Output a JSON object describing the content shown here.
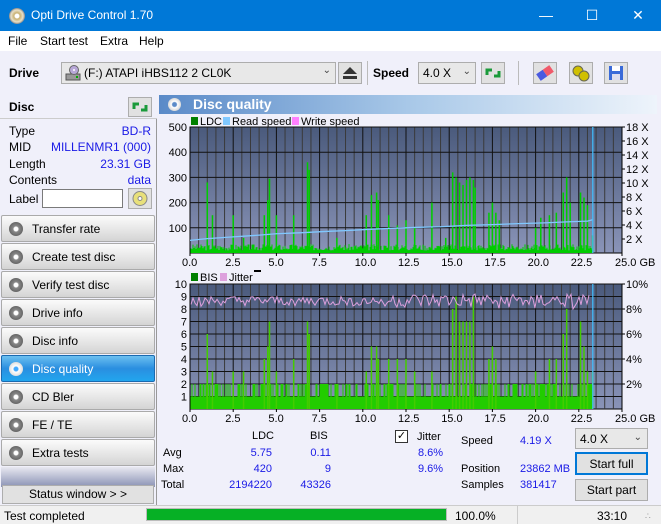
{
  "window": {
    "title": "Opti Drive Control 1.70",
    "controls": [
      "minimize",
      "maximize",
      "close"
    ]
  },
  "menu": [
    "File",
    "Start test",
    "Extra",
    "Help"
  ],
  "toolbar": {
    "drive_label": "Drive",
    "drive_value": "(F:)  ATAPI iHBS112  2 CL0K",
    "speed_label": "Speed",
    "speed_value": "4.0 X"
  },
  "disc": {
    "header": "Disc",
    "rows": [
      {
        "key": "Type",
        "value": "BD-R"
      },
      {
        "key": "MID",
        "value": "MILLENMR1 (000)"
      },
      {
        "key": "Length",
        "value": "23.31 GB"
      },
      {
        "key": "Contents",
        "value": "data"
      }
    ],
    "label_key": "Label",
    "label_value": ""
  },
  "nav": [
    {
      "label": "Transfer rate",
      "active": false
    },
    {
      "label": "Create test disc",
      "active": false
    },
    {
      "label": "Verify test disc",
      "active": false
    },
    {
      "label": "Drive info",
      "active": false
    },
    {
      "label": "Disc info",
      "active": false
    },
    {
      "label": "Disc quality",
      "active": true
    },
    {
      "label": "CD Bler",
      "active": false
    },
    {
      "label": "FE / TE",
      "active": false
    },
    {
      "label": "Extra tests",
      "active": false
    }
  ],
  "status_window_label": "Status window > >",
  "panel_title": "Disc quality",
  "chart_data": [
    {
      "type": "bar",
      "title": "LDC / Read speed",
      "legend": [
        "LDC",
        "Read speed",
        "Write speed"
      ],
      "legend_colors": [
        "#008000",
        "#80c8ff",
        "#ff80ff"
      ],
      "legend_placement": "top-left",
      "xlabel": "GB",
      "x_ticks": [
        "0.0",
        "2.5",
        "5.0",
        "7.5",
        "10.0",
        "12.5",
        "15.0",
        "17.5",
        "20.0",
        "22.5",
        "25.0 GB"
      ],
      "xlim": [
        0,
        25
      ],
      "y_ticks": [
        "100",
        "200",
        "300",
        "400",
        "500"
      ],
      "ylim": [
        0,
        500
      ],
      "y2_ticks": [
        "2 X",
        "4 X",
        "6 X",
        "8 X",
        "10 X",
        "12 X",
        "14 X",
        "16 X",
        "18 X"
      ],
      "y2lim": [
        0,
        18
      ],
      "ldc_peaks": [
        [
          1.0,
          280
        ],
        [
          1.3,
          150
        ],
        [
          2.5,
          150
        ],
        [
          3.1,
          60
        ],
        [
          4.3,
          150
        ],
        [
          4.5,
          210
        ],
        [
          4.6,
          295
        ],
        [
          5.0,
          150
        ],
        [
          6.0,
          150
        ],
        [
          6.8,
          360
        ],
        [
          6.9,
          330
        ],
        [
          8.5,
          60
        ],
        [
          10.2,
          150
        ],
        [
          10.5,
          230
        ],
        [
          10.8,
          240
        ],
        [
          10.9,
          210
        ],
        [
          11.5,
          150
        ],
        [
          12.0,
          110
        ],
        [
          12.5,
          130
        ],
        [
          13.0,
          100
        ],
        [
          14.0,
          200
        ],
        [
          14.8,
          60
        ],
        [
          15.2,
          320
        ],
        [
          15.4,
          300
        ],
        [
          15.6,
          280
        ],
        [
          15.8,
          270
        ],
        [
          16.0,
          290
        ],
        [
          16.2,
          300
        ],
        [
          16.4,
          290
        ],
        [
          16.5,
          260
        ],
        [
          17.3,
          160
        ],
        [
          17.5,
          200
        ],
        [
          17.7,
          160
        ],
        [
          17.9,
          130
        ],
        [
          20.0,
          100
        ],
        [
          20.3,
          140
        ],
        [
          20.8,
          150
        ],
        [
          21.2,
          160
        ],
        [
          21.6,
          240
        ],
        [
          21.8,
          300
        ],
        [
          22.0,
          200
        ],
        [
          22.6,
          240
        ],
        [
          22.8,
          220
        ],
        [
          23.0,
          190
        ],
        [
          23.3,
          70
        ]
      ],
      "ldc_baseline": 10,
      "read_speed": [
        [
          0,
          1.8
        ],
        [
          1,
          2.05
        ],
        [
          2.5,
          2.3
        ],
        [
          4,
          2.55
        ],
        [
          5,
          2.75
        ],
        [
          6.5,
          2.9
        ],
        [
          8,
          3.1
        ],
        [
          9,
          3.2
        ],
        [
          10.5,
          3.4
        ],
        [
          11.5,
          3.5
        ],
        [
          13,
          3.65
        ],
        [
          14.5,
          3.75
        ],
        [
          16,
          3.95
        ],
        [
          17.5,
          4.05
        ],
        [
          19,
          4.2
        ],
        [
          20.5,
          4.3
        ],
        [
          21.8,
          4.45
        ],
        [
          23,
          4.55
        ],
        [
          23.3,
          4.75
        ]
      ],
      "end_marker_gb": 23.31
    },
    {
      "type": "bar",
      "title": "BIS / Jitter",
      "legend": [
        "BIS",
        "Jitter"
      ],
      "legend_colors": [
        "#008000",
        "#dda0dd"
      ],
      "legend_placement": "top-left",
      "xlabel": "GB",
      "x_ticks": [
        "0.0",
        "2.5",
        "5.0",
        "7.5",
        "10.0",
        "12.5",
        "15.0",
        "17.5",
        "20.0",
        "22.5",
        "25.0 GB"
      ],
      "xlim": [
        0,
        25
      ],
      "y_ticks": [
        "1",
        "2",
        "3",
        "4",
        "5",
        "6",
        "7",
        "8",
        "9",
        "10"
      ],
      "ylim": [
        0,
        10
      ],
      "y2_ticks": [
        "2%",
        "4%",
        "6%",
        "8%",
        "10%"
      ],
      "y2lim": [
        0,
        10
      ],
      "bis_peaks": [
        [
          1.0,
          6
        ],
        [
          1.3,
          3
        ],
        [
          2.5,
          3
        ],
        [
          3.1,
          3
        ],
        [
          4.3,
          4
        ],
        [
          4.5,
          5
        ],
        [
          4.6,
          7
        ],
        [
          5.0,
          3
        ],
        [
          6.0,
          4
        ],
        [
          6.8,
          7
        ],
        [
          6.9,
          6
        ],
        [
          8.5,
          2
        ],
        [
          10.2,
          3
        ],
        [
          10.5,
          5
        ],
        [
          10.8,
          5
        ],
        [
          10.9,
          4
        ],
        [
          11.5,
          4
        ],
        [
          12.0,
          4
        ],
        [
          12.5,
          4
        ],
        [
          13.0,
          3
        ],
        [
          14.0,
          3
        ],
        [
          15.2,
          8
        ],
        [
          15.4,
          9
        ],
        [
          15.6,
          7
        ],
        [
          15.8,
          7
        ],
        [
          16.0,
          7
        ],
        [
          16.2,
          7
        ],
        [
          16.4,
          9
        ],
        [
          17.3,
          4
        ],
        [
          17.5,
          5
        ],
        [
          17.7,
          4
        ],
        [
          20.0,
          3
        ],
        [
          20.8,
          4
        ],
        [
          21.2,
          4
        ],
        [
          21.6,
          6
        ],
        [
          21.8,
          8
        ],
        [
          22.6,
          7
        ],
        [
          22.8,
          5
        ],
        [
          23.0,
          3
        ],
        [
          23.3,
          3
        ]
      ],
      "bis_baseline": 1,
      "jitter_mean_pct": 8.6,
      "jitter_max_pct": 9.6,
      "end_marker_gb": 23.31
    }
  ],
  "stats": {
    "headers": [
      "LDC",
      "BIS"
    ],
    "avg_label": "Avg",
    "avg_ldc": "5.75",
    "avg_bis": "0.11",
    "max_label": "Max",
    "max_ldc": "420",
    "max_bis": "9",
    "total_label": "Total",
    "total_ldc": "2194220",
    "total_bis": "43326",
    "jitter_label": "Jitter",
    "jitter_checked": true,
    "jitter_avg": "8.6%",
    "jitter_max": "9.6%",
    "speed_label": "Speed",
    "speed_value": "4.19 X",
    "position_label": "Position",
    "position_value": "23862 MB",
    "samples_label": "Samples",
    "samples_value": "381417",
    "speed_select": "4.0 X",
    "start_full": "Start full",
    "start_part": "Start part"
  },
  "status": {
    "text": "Test completed",
    "progress": 100.0,
    "progress_text": "100.0%",
    "time": "33:10"
  }
}
